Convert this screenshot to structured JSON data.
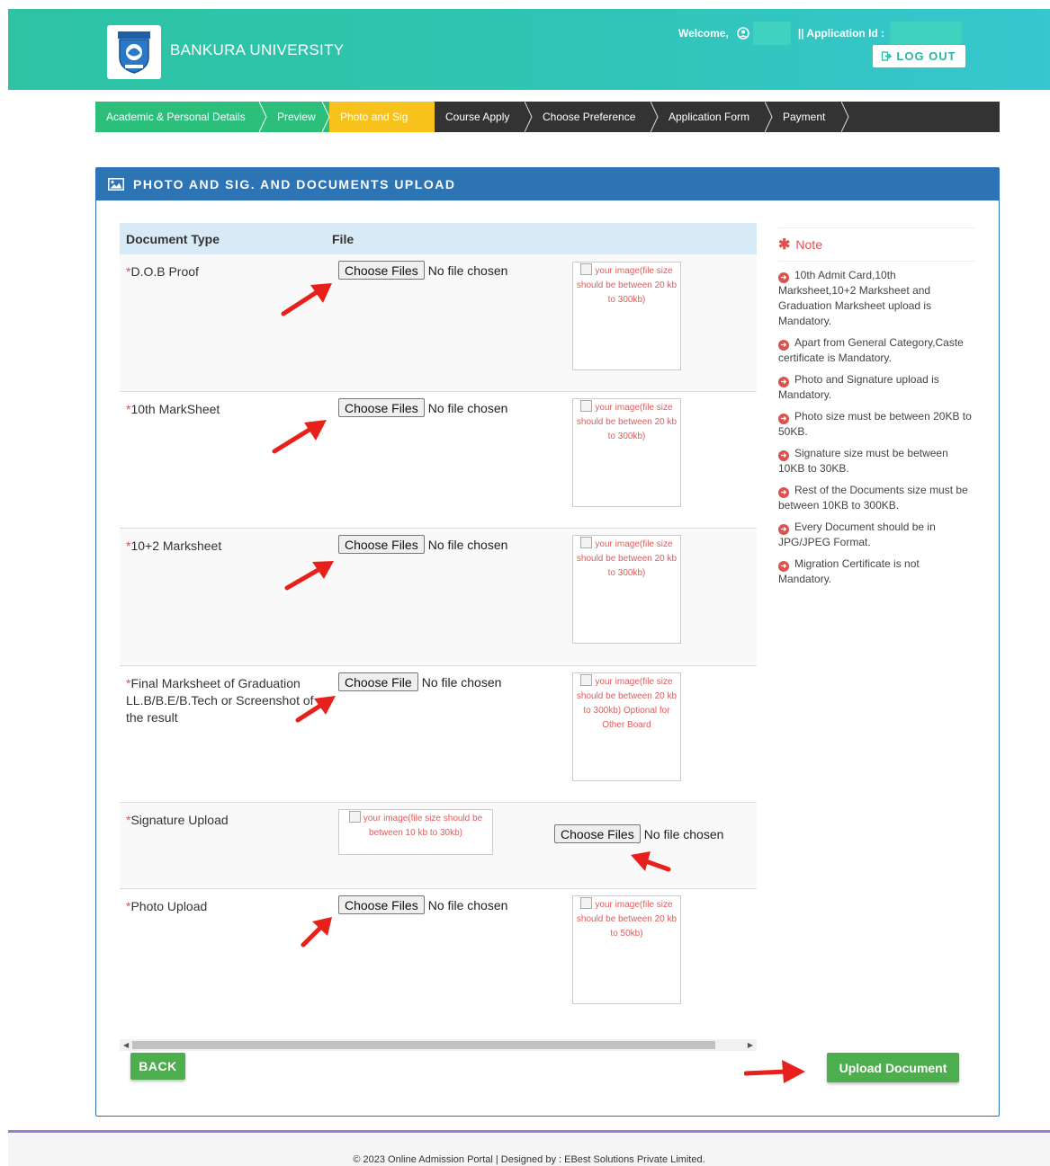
{
  "header": {
    "university_name": "BANKURA UNIVERSITY",
    "welcome_label": "Welcome,",
    "application_id_label": "|| Application Id :",
    "logout_label": "LOG OUT"
  },
  "steps": [
    {
      "label": "Academic & Personal Details",
      "state": "done"
    },
    {
      "label": "Preview",
      "state": "done"
    },
    {
      "label": "Photo and Sig",
      "state": "active"
    },
    {
      "label": "Course Apply",
      "state": "pending"
    },
    {
      "label": "Choose Preference",
      "state": "pending"
    },
    {
      "label": "Application Form",
      "state": "pending"
    },
    {
      "label": "Payment",
      "state": "pending"
    }
  ],
  "panel": {
    "title": "PHOTO AND SIG. AND DOCUMENTS UPLOAD"
  },
  "table": {
    "col_type": "Document Type",
    "col_file": "File",
    "rows": [
      {
        "label": "D.O.B Proof",
        "button": "Choose Files",
        "status": "No file chosen",
        "preview": "your image(file size should be between 20 kb to 300kb)"
      },
      {
        "label": "10th MarkSheet",
        "button": "Choose Files",
        "status": "No file chosen",
        "preview": "your image(file size should be between 20 kb to 300kb)"
      },
      {
        "label": "10+2 Marksheet",
        "button": "Choose Files",
        "status": "No file chosen",
        "preview": "your image(file size should be between 20 kb to 300kb)"
      },
      {
        "label": "Final Marksheet of Graduation LL.B/B.E/B.Tech or Screenshot of the result",
        "button": "Choose File",
        "status": "No file chosen",
        "preview": "your image(file size should be between 20 kb to 300kb) Optional for Other Board"
      },
      {
        "label": "Signature Upload",
        "button": "Choose Files",
        "status": "No file chosen",
        "preview": "your image(file size should be between 10 kb to 30kb)"
      },
      {
        "label": "Photo Upload",
        "button": "Choose Files",
        "status": "No file chosen",
        "preview": "your image(file size should be between 20 kb to 50kb)"
      }
    ]
  },
  "buttons": {
    "back": "BACK",
    "upload": "Upload Document"
  },
  "note": {
    "title": "Note",
    "items": [
      "10th Admit Card,10th Marksheet,10+2 Marksheet and Graduation Marksheet upload is Mandatory.",
      "Apart from General Category,Caste certificate is Mandatory.",
      "Photo and Signature upload is Mandatory.",
      "Photo size must be between 20KB to 50KB.",
      "Signature size must be between 10KB to 30KB.",
      "Rest of the Documents size must be between 10KB to 300KB.",
      "Every Document should be in JPG/JPEG Format.",
      "Migration Certificate is not Mandatory."
    ]
  },
  "footer": {
    "text": "© 2023 Online Admission Portal | Designed by : EBest Solutions Private Limited."
  },
  "colors": {
    "header_start": "#2dc3a3",
    "header_end": "#36c7cf",
    "step_done": "#2cbf7c",
    "step_active": "#f6c21b",
    "step_bar": "#333333",
    "panel_blue": "#2d74b5",
    "button_green": "#4cae4c",
    "required_red": "#d9534f"
  }
}
